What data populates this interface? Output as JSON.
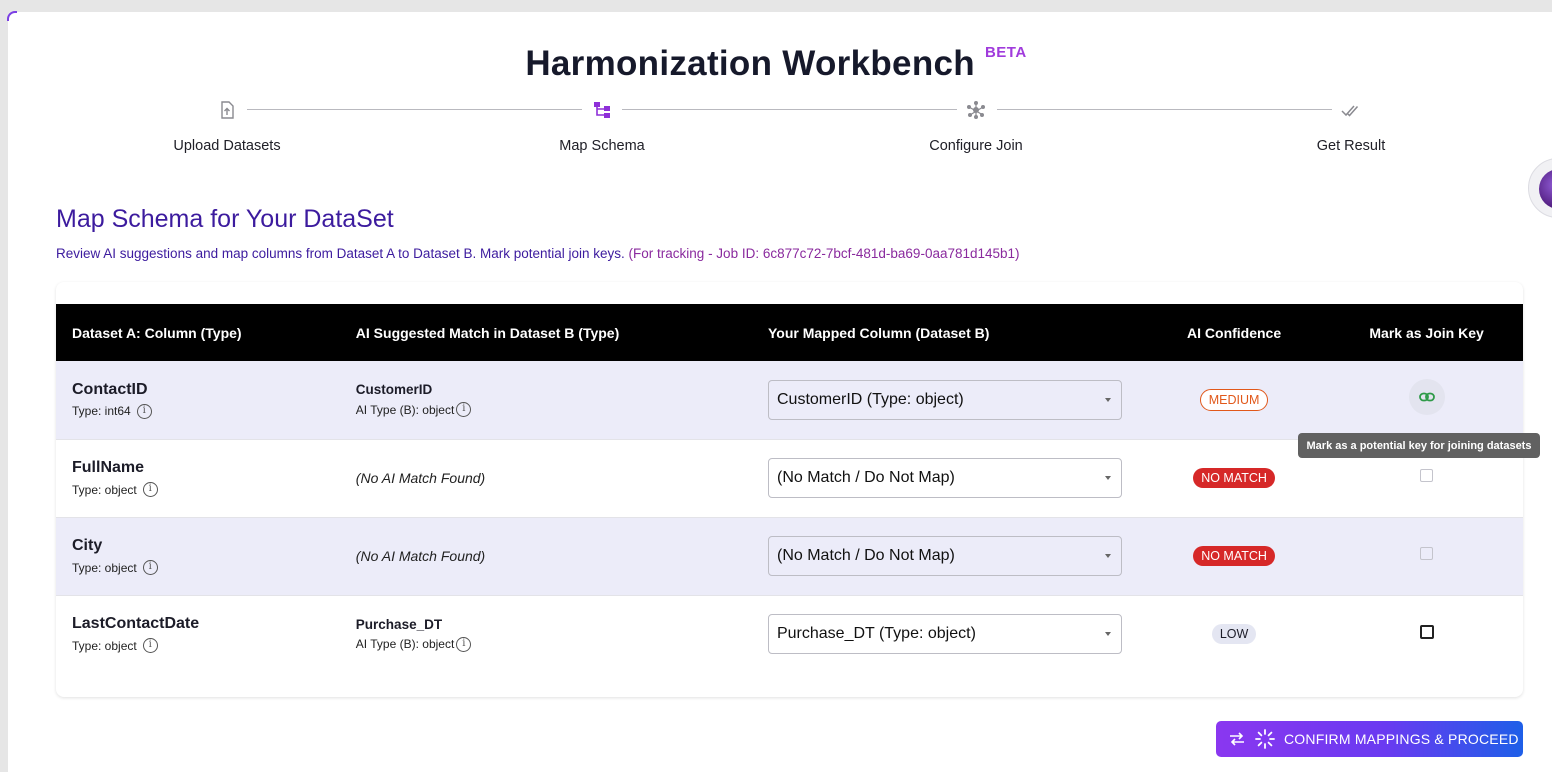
{
  "header": {
    "title": "Harmonization Workbench",
    "badge": "BETA"
  },
  "stepper": {
    "steps": [
      {
        "label": "Upload Datasets",
        "icon": "upload-file-icon"
      },
      {
        "label": "Map Schema",
        "icon": "schema-icon",
        "active": true
      },
      {
        "label": "Configure Join",
        "icon": "hub-icon"
      },
      {
        "label": "Get Result",
        "icon": "double-check-icon"
      }
    ]
  },
  "section": {
    "title": "Map Schema for Your DataSet",
    "description": "Review AI suggestions and map columns from Dataset A to Dataset B. Mark potential join keys.",
    "tracking": "(For tracking - Job ID: 6c877c72-7bcf-481d-ba69-0aa781d145b1)"
  },
  "table": {
    "headers": {
      "col_a": "Dataset A: Column (Type)",
      "ai_match": "AI Suggested Match in Dataset B (Type)",
      "mapped": "Your Mapped Column (Dataset B)",
      "confidence": "AI Confidence",
      "join_key": "Mark as Join Key"
    },
    "rows": [
      {
        "name": "ContactID",
        "type": "Type: int64",
        "ai_name": "CustomerID",
        "ai_type": "AI Type (B): object",
        "ai_none": "",
        "mapped": "CustomerID (Type: object)",
        "confidence": "MEDIUM"
      },
      {
        "name": "FullName",
        "type": "Type: object",
        "ai_name": "",
        "ai_type": "",
        "ai_none": "(No AI Match Found)",
        "mapped": "(No Match / Do Not Map)",
        "confidence": "NO MATCH"
      },
      {
        "name": "City",
        "type": "Type: object",
        "ai_name": "",
        "ai_type": "",
        "ai_none": "(No AI Match Found)",
        "mapped": "(No Match / Do Not Map)",
        "confidence": "NO MATCH"
      },
      {
        "name": "LastContactDate",
        "type": "Type: object",
        "ai_name": "Purchase_DT",
        "ai_type": "AI Type (B): object",
        "ai_none": "",
        "mapped": "Purchase_DT (Type: object)",
        "confidence": "LOW"
      }
    ]
  },
  "tooltip": "Mark as a potential key for joining datasets",
  "confirm_button": "CONFIRM MAPPINGS & PROCEED",
  "colors": {
    "accent": "#3c1b9e",
    "beta": "#a03bdc",
    "no_match": "#d62828",
    "medium": "#e1581a"
  }
}
